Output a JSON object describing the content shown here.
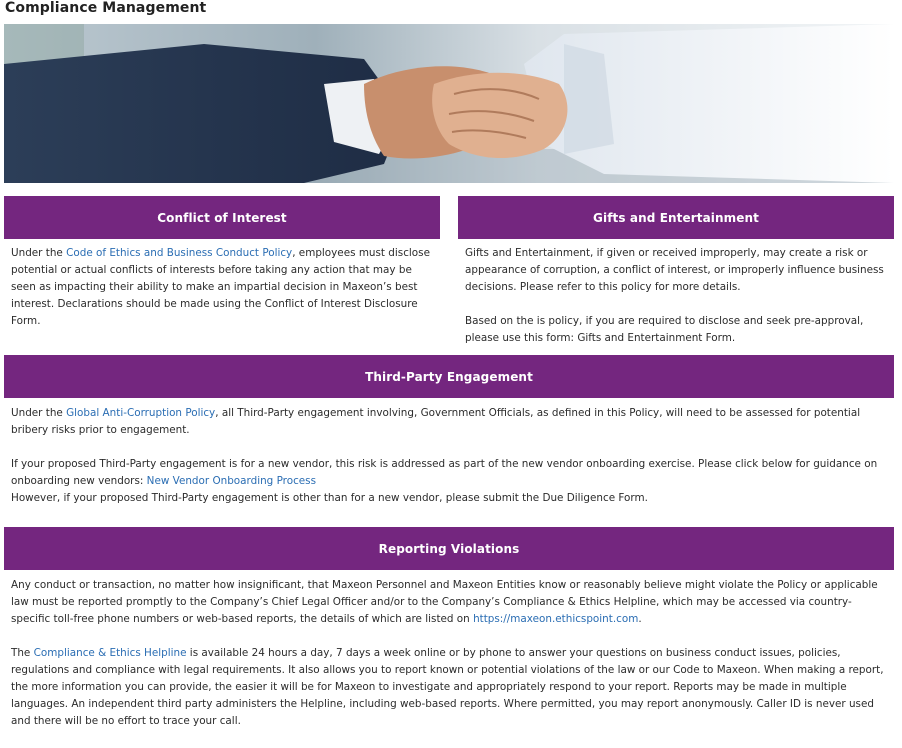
{
  "page": {
    "title": "Compliance Management"
  },
  "hero": {
    "image": "handshake-photo"
  },
  "coi": {
    "header": "Conflict of Interest",
    "p1_a": "Under the ",
    "p1_link": "Code of Ethics and Business Conduct Policy",
    "p1_b": ", employees must disclose potential or actual conflicts of interests before taking any action that may be seen as impacting their ability to make an impartial decision in Maxeon’s best interest. Declarations should be made using the ",
    "p1_form": "Conflict of Interest Disclosure Form",
    "p1_c": "."
  },
  "gifts": {
    "header": "Gifts and Entertainment",
    "p1": "Gifts and Entertainment, if given or received improperly, may create a risk or appearance of corruption, a conflict of interest, or improperly influence business decisions. Please refer to this policy for more details.",
    "p2_a": "Based on the is policy, if you are required to disclose and seek pre-approval, please use this form: ",
    "p2_form": "Gifts and Entertainment Form",
    "p2_b": "."
  },
  "third_party": {
    "header": "Third-Party Engagement",
    "p1_a": "Under the ",
    "p1_link": "Global Anti-Corruption Policy",
    "p1_b": ", all Third-Party engagement involving, Government Officials, as defined in this Policy, will need to be assessed for potential bribery risks prior to engagement.",
    "p2_a": "If your proposed Third-Party engagement is for a new vendor, this risk is addressed as part of the new vendor onboarding exercise. Please click below for guidance on onboarding new vendors: ",
    "p2_link": "New Vendor Onboarding Process",
    "p3_a": "However, if your proposed Third-Party engagement is other than for a new vendor, please submit the ",
    "p3_form": "Due Diligence Form",
    "p3_b": "."
  },
  "reporting": {
    "header": "Reporting Violations",
    "p1_a": "Any conduct or transaction, no matter how insignificant, that Maxeon Personnel and Maxeon Entities know or reasonably believe might violate the Policy or applicable law must be reported promptly to the Company’s Chief Legal Officer and/or to the Company’s Compliance & Ethics Helpline, which may be accessed via country-specific toll-free phone numbers or web-based reports, the details of which are listed on ",
    "p1_link": "https://maxeon.ethicspoint.com",
    "p1_b": ".",
    "p2_a": "The ",
    "p2_link": "Compliance & Ethics Helpline",
    "p2_b": " is available 24 hours a day, 7 days a week online or by phone to answer your questions on business conduct issues, policies, regulations and compliance with legal requirements. It also allows you to report known or potential violations of the law or our Code to Maxeon. When making a report, the more information you can provide, the easier it will be for Maxeon to investigate and appropriately respond to your report. Reports may be made in multiple languages. An independent third party administers the Helpline, including web-based reports. Where permitted, you may report anonymously. Caller ID is never used and there will be no effort to trace your call."
  },
  "colors": {
    "header_bg": "#74267f",
    "link": "#2a6db3"
  }
}
